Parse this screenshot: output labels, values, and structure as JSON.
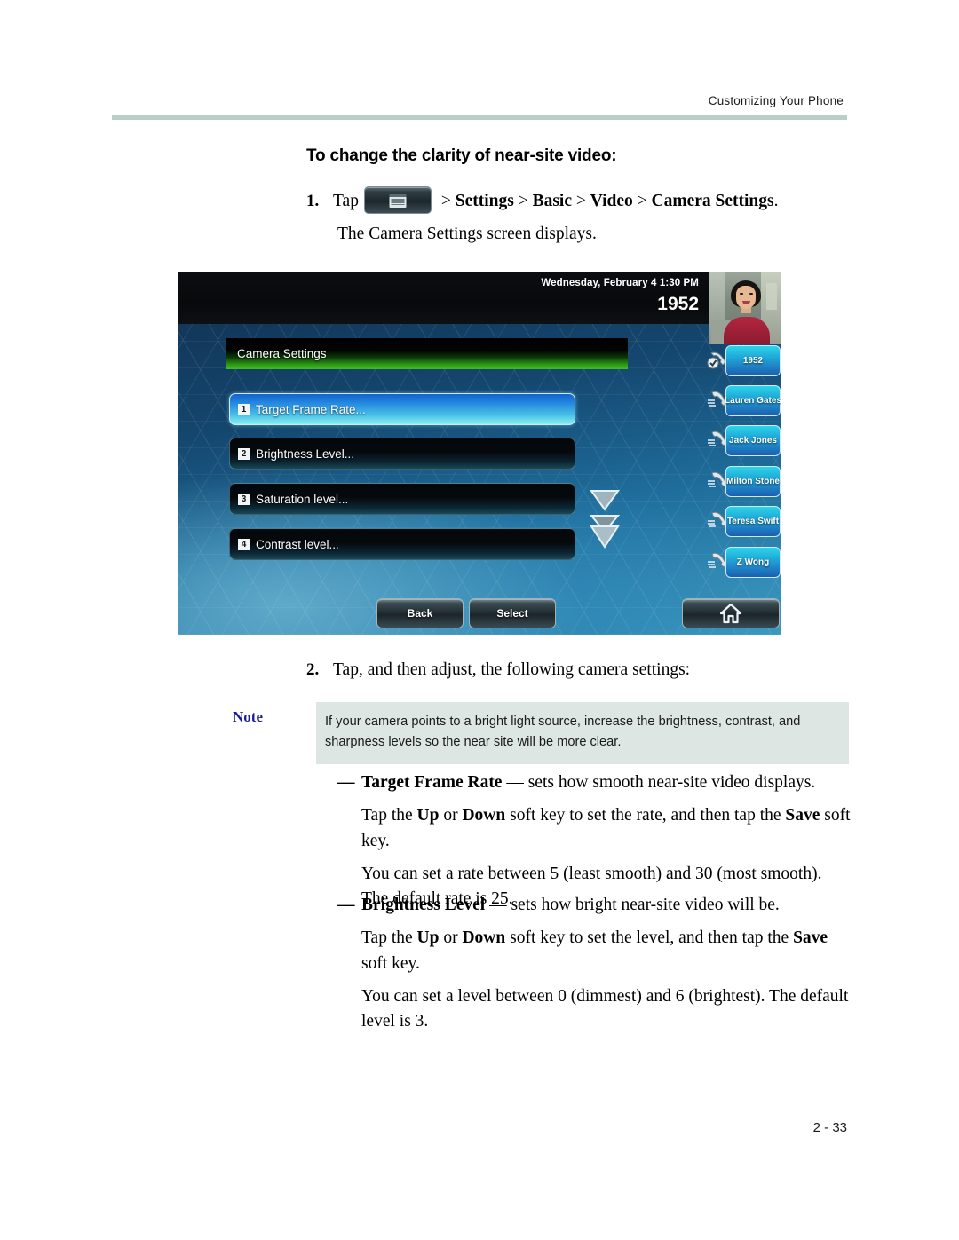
{
  "page": {
    "running_head": "Customizing Your Phone",
    "folio": "2 - 33",
    "section_title": "To change the clarity of near-site video:"
  },
  "steps": [
    {
      "number": "1.",
      "lead": "Tap",
      "icon": "home-menu-key-icon",
      "trail_plain_1": " > ",
      "trail_bold_1": "Settings",
      "trail_plain_2": " > ",
      "trail_bold_2": "Basic",
      "trail_plain_3": " > ",
      "trail_bold_3": "Video",
      "trail_plain_4": " > ",
      "trail_bold_4": "Camera Settings",
      "trail_end": ".",
      "sub": "The Camera Settings screen displays."
    },
    {
      "number": "2.",
      "text": "Tap, and then adjust, the following camera settings:"
    }
  ],
  "note": {
    "label": "Note",
    "text": "If your camera points to a bright light source, increase the brightness, contrast, and sharpness levels so the near site will be more clear.",
    "background": "#dde6e3",
    "label_color": "#1d1d9c"
  },
  "bullets": [
    {
      "dash": "—",
      "term": "Target Frame Rate",
      "sep": " — ",
      "definition": "sets how smooth near-site video displays.",
      "para1_a": "Tap the ",
      "para1_b1": "Up",
      "para1_c": " or ",
      "para1_b2": "Down",
      "para1_d": " soft key to set the rate, and then tap the ",
      "para1_b3": "Save",
      "para1_e": " soft key.",
      "para2": "You can set a rate between 5 (least smooth) and 30 (most smooth). The default rate is 25."
    },
    {
      "dash": "—",
      "term": "Brightness Level",
      "sep": " — ",
      "definition": "sets how bright near-site video will be.",
      "para1_a": "Tap the ",
      "para1_b1": "Up",
      "para1_c": " or ",
      "para1_b2": "Down",
      "para1_d": " soft key to set the level, and then tap the ",
      "para1_b3": "Save",
      "para1_e": " soft key.",
      "para2": "You can set a level between 0 (dimmest) and 6 (brightest). The default level is 3."
    }
  ],
  "phone": {
    "status": {
      "date_time": "Wednesday, February 4  1:30 PM",
      "extension": "1952"
    },
    "video_thumbnail": "near-site-video-thumbnail",
    "menu_title": "Camera Settings",
    "menu_items": [
      {
        "index": "1",
        "label": "Target Frame Rate...",
        "selected": true
      },
      {
        "index": "2",
        "label": "Brightness Level...",
        "selected": false
      },
      {
        "index": "3",
        "label": "Saturation level...",
        "selected": false
      },
      {
        "index": "4",
        "label": "Contrast level...",
        "selected": false
      }
    ],
    "scroll_indicators": [
      "scroll-down-icon",
      "scroll-page-down-icon"
    ],
    "line_keys": [
      {
        "label": "1952",
        "icon": "handset-registered-icon"
      },
      {
        "label": "Lauren Gates",
        "icon": "handset-icon"
      },
      {
        "label": "Jack Jones",
        "icon": "handset-icon"
      },
      {
        "label": "Milton Stone",
        "icon": "handset-icon"
      },
      {
        "label": "Teresa Swift",
        "icon": "handset-icon"
      },
      {
        "label": "Z Wong",
        "icon": "handset-icon"
      }
    ],
    "soft_keys": [
      {
        "label": "Back"
      },
      {
        "label": "Select"
      }
    ],
    "home_key": "home-icon",
    "colors": {
      "title_bar_green": "#3fbd1d",
      "selected_row_cyan": "#8ef0f2",
      "line_key_blue": "#22b5dd"
    }
  }
}
